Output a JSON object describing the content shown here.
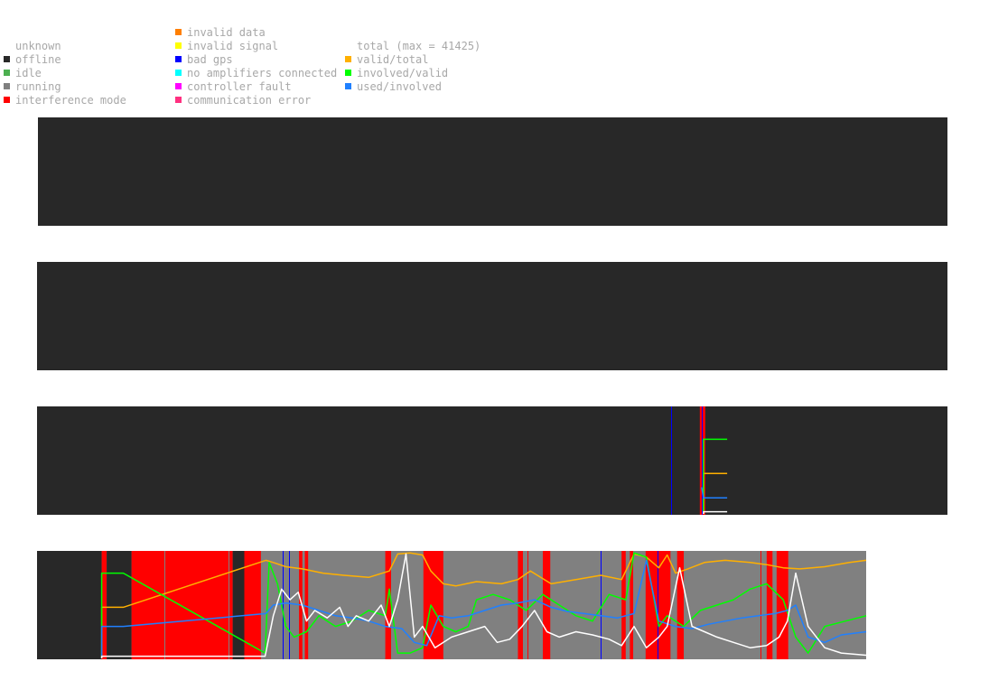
{
  "legend": {
    "status": [
      {
        "label": "unknown",
        "color": null
      },
      {
        "label": "offline",
        "color": "#282828"
      },
      {
        "label": "idle",
        "color": "#4caf50"
      },
      {
        "label": "running",
        "color": "#808080"
      },
      {
        "label": "interference mode",
        "color": "#ff0000"
      }
    ],
    "errors": [
      {
        "label": "invalid data",
        "color": "#ff7f00"
      },
      {
        "label": "invalid signal",
        "color": "#ffff00"
      },
      {
        "label": "bad gps",
        "color": "#0000ff"
      },
      {
        "label": "no amplifiers connected",
        "color": "#00ffff"
      },
      {
        "label": "controller fault",
        "color": "#ff00ff"
      },
      {
        "label": "communication error",
        "color": "#ff3080"
      }
    ],
    "signals": [
      {
        "label": "total (max = 41425)",
        "color": null
      },
      {
        "label": "valid/total",
        "color": "#ffb000"
      },
      {
        "label": "involved/valid",
        "color": "#00ff00"
      },
      {
        "label": "used/involved",
        "color": "#2080ff"
      }
    ]
  },
  "chart_data": [
    {
      "type": "area",
      "background": "#282828",
      "x_range": [
        0,
        100
      ],
      "y_range": [
        0,
        1
      ],
      "segments": [],
      "lines": [],
      "series": []
    },
    {
      "type": "area",
      "background": "#282828",
      "x_range": [
        0,
        100
      ],
      "y_range": [
        0,
        1
      ],
      "segments": [],
      "lines": [],
      "series": []
    },
    {
      "type": "area",
      "background": "#282828",
      "x_range": [
        0,
        100
      ],
      "y_range": [
        0,
        1
      ],
      "segments": [
        {
          "from": 72.8,
          "to": 73.4,
          "status": "interference mode"
        }
      ],
      "lines": [
        {
          "x": 69.6,
          "status": "bad gps"
        },
        {
          "x": 73.0,
          "status": "bad gps"
        }
      ],
      "series": [
        {
          "status": "valid/total",
          "x": [
            73.2,
            73.2,
            75.8
          ],
          "y": [
            0,
            0.38,
            0.38
          ]
        },
        {
          "status": "involved/valid",
          "x": [
            73.2,
            73.2,
            75.8
          ],
          "y": [
            0,
            0.7,
            0.7
          ]
        },
        {
          "status": "used/involved",
          "x": [
            73.0,
            73.2,
            75.8
          ],
          "y": [
            0.25,
            0.15,
            0.15
          ]
        },
        {
          "status": "total",
          "x": [
            73.2,
            73.2,
            75.8
          ],
          "y": [
            0,
            0.02,
            0.02
          ]
        }
      ]
    },
    {
      "type": "area",
      "background": "#808080",
      "x_range": [
        0,
        100
      ],
      "y_range": [
        0,
        1
      ],
      "segments": [
        {
          "from": 0,
          "to": 7.8,
          "status": "offline"
        },
        {
          "from": 7.8,
          "to": 8.4,
          "status": "interference mode"
        },
        {
          "from": 8.4,
          "to": 11.4,
          "status": "offline"
        },
        {
          "from": 11.4,
          "to": 23.6,
          "status": "interference mode"
        },
        {
          "from": 23.6,
          "to": 25.0,
          "status": "offline"
        },
        {
          "from": 25.0,
          "to": 27.0,
          "status": "interference mode"
        },
        {
          "from": 31.6,
          "to": 32.0,
          "status": "interference mode"
        },
        {
          "from": 32.3,
          "to": 32.7,
          "status": "interference mode"
        },
        {
          "from": 42.0,
          "to": 42.7,
          "status": "interference mode"
        },
        {
          "from": 46.6,
          "to": 49.0,
          "status": "interference mode"
        },
        {
          "from": 58.0,
          "to": 58.6,
          "status": "interference mode"
        },
        {
          "from": 61.0,
          "to": 61.9,
          "status": "interference mode"
        },
        {
          "from": 70.5,
          "to": 71.0,
          "status": "interference mode"
        },
        {
          "from": 71.5,
          "to": 71.9,
          "status": "interference mode"
        },
        {
          "from": 73.4,
          "to": 76.4,
          "status": "interference mode"
        },
        {
          "from": 77.2,
          "to": 78.0,
          "status": "interference mode"
        },
        {
          "from": 88.0,
          "to": 88.7,
          "status": "interference mode"
        },
        {
          "from": 89.2,
          "to": 90.6,
          "status": "interference mode"
        }
      ],
      "lines": [
        {
          "x": 15.4,
          "status": "running"
        },
        {
          "x": 23.1,
          "status": "running"
        },
        {
          "x": 29.6,
          "status": "bad gps"
        },
        {
          "x": 30.4,
          "status": "bad gps"
        },
        {
          "x": 59.2,
          "status": "interference mode"
        },
        {
          "x": 68.0,
          "status": "bad gps"
        },
        {
          "x": 74.8,
          "status": "bad gps"
        },
        {
          "x": 87.3,
          "status": "interference mode"
        }
      ],
      "series": [
        {
          "status": "valid/total",
          "x": [
            7.8,
            7.8,
            10.4,
            27.6,
            28.5,
            30.0,
            32.0,
            34.5,
            37.0,
            40.0,
            42.5,
            43.5,
            45.0,
            46.5,
            47.5,
            49.0,
            50.5,
            53.0,
            56.0,
            58.0,
            59.5,
            62.0,
            65.0,
            68.0,
            70.5,
            72.0,
            73.5,
            75.0,
            76.0,
            77.0,
            78.5,
            80.5,
            83.0,
            86.0,
            88.0,
            90.0,
            92.0,
            95.0,
            98.0,
            100.0
          ],
          "y": [
            0,
            0.48,
            0.48,
            0.92,
            0.9,
            0.86,
            0.84,
            0.8,
            0.78,
            0.76,
            0.82,
            0.98,
            0.99,
            0.97,
            0.82,
            0.7,
            0.68,
            0.72,
            0.7,
            0.74,
            0.82,
            0.7,
            0.74,
            0.78,
            0.74,
            0.98,
            0.95,
            0.85,
            0.97,
            0.8,
            0.84,
            0.9,
            0.92,
            0.9,
            0.88,
            0.85,
            0.84,
            0.86,
            0.9,
            0.92
          ]
        },
        {
          "status": "involved/valid",
          "x": [
            7.8,
            7.8,
            10.4,
            27.5,
            28.0,
            29.0,
            30.0,
            31.0,
            32.5,
            34.0,
            36.0,
            38.0,
            40.0,
            42.0,
            42.5,
            43.5,
            45.0,
            46.5,
            47.5,
            49.0,
            50.5,
            52.0,
            53.0,
            55.0,
            57.0,
            59.0,
            61.0,
            63.0,
            65.0,
            67.0,
            69.0,
            71.0,
            72.0,
            73.5,
            75.0,
            76.0,
            78.0,
            80.0,
            82.0,
            84.0,
            86.0,
            88.0,
            90.0,
            91.5,
            93.0,
            95.0,
            97.5,
            100.0
          ],
          "y": [
            0,
            0.8,
            0.8,
            0.05,
            0.9,
            0.7,
            0.3,
            0.2,
            0.25,
            0.4,
            0.3,
            0.35,
            0.45,
            0.4,
            0.65,
            0.05,
            0.05,
            0.1,
            0.5,
            0.3,
            0.25,
            0.3,
            0.55,
            0.6,
            0.55,
            0.45,
            0.6,
            0.5,
            0.4,
            0.35,
            0.6,
            0.55,
            0.99,
            0.95,
            0.3,
            0.4,
            0.3,
            0.45,
            0.5,
            0.55,
            0.65,
            0.7,
            0.55,
            0.2,
            0.05,
            0.3,
            0.35,
            0.4
          ]
        },
        {
          "status": "used/involved",
          "x": [
            7.8,
            7.8,
            10.4,
            27.6,
            28.5,
            30.0,
            32.0,
            34.0,
            36.0,
            38.0,
            40.0,
            42.0,
            44.0,
            45.5,
            47.0,
            48.5,
            50.0,
            52.0,
            54.0,
            56.0,
            58.0,
            60.0,
            62.0,
            64.0,
            66.0,
            68.0,
            70.0,
            72.0,
            73.5,
            75.0,
            77.0,
            79.0,
            81.0,
            83.0,
            85.0,
            87.0,
            89.0,
            90.5,
            91.5,
            93.0,
            95.0,
            97.0,
            100.0
          ],
          "y": [
            0,
            0.3,
            0.3,
            0.42,
            0.5,
            0.52,
            0.5,
            0.45,
            0.4,
            0.38,
            0.35,
            0.3,
            0.28,
            0.15,
            0.12,
            0.4,
            0.38,
            0.4,
            0.45,
            0.5,
            0.52,
            0.55,
            0.48,
            0.44,
            0.42,
            0.4,
            0.38,
            0.42,
            0.92,
            0.35,
            0.3,
            0.28,
            0.32,
            0.35,
            0.38,
            0.4,
            0.42,
            0.45,
            0.5,
            0.2,
            0.15,
            0.22,
            0.25
          ]
        },
        {
          "status": "total",
          "x": [
            7.8,
            7.8,
            10.4,
            27.5,
            28.5,
            29.5,
            30.5,
            31.5,
            32.5,
            33.5,
            35.0,
            36.5,
            37.5,
            38.5,
            40.0,
            41.5,
            42.5,
            43.5,
            44.5,
            45.5,
            46.5,
            48.0,
            50.0,
            52.0,
            54.0,
            55.5,
            57.0,
            58.5,
            60.0,
            61.5,
            63.0,
            65.0,
            67.0,
            69.0,
            70.5,
            72.0,
            73.5,
            75.0,
            76.0,
            77.5,
            79.0,
            80.5,
            82.0,
            84.0,
            86.0,
            88.0,
            89.5,
            90.5,
            91.5,
            93.0,
            95.0,
            97.0,
            100.0
          ],
          "y": [
            0,
            0.02,
            0.02,
            0.02,
            0.4,
            0.65,
            0.55,
            0.62,
            0.35,
            0.45,
            0.38,
            0.48,
            0.3,
            0.4,
            0.35,
            0.5,
            0.3,
            0.55,
            0.98,
            0.2,
            0.3,
            0.1,
            0.2,
            0.25,
            0.3,
            0.15,
            0.18,
            0.3,
            0.45,
            0.25,
            0.2,
            0.25,
            0.22,
            0.18,
            0.12,
            0.3,
            0.1,
            0.2,
            0.3,
            0.85,
            0.3,
            0.25,
            0.2,
            0.15,
            0.1,
            0.12,
            0.2,
            0.35,
            0.8,
            0.3,
            0.1,
            0.05,
            0.03
          ]
        }
      ]
    }
  ]
}
